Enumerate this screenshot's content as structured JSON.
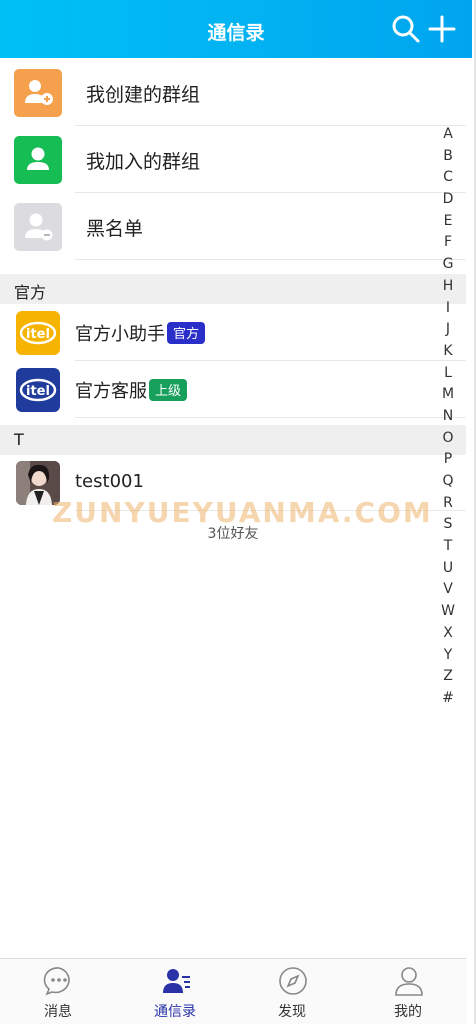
{
  "header": {
    "title": "通信录"
  },
  "groups": [
    {
      "label": "我创建的群组",
      "icon": "create-group-icon",
      "color": "#f5a04c"
    },
    {
      "label": "我加入的群组",
      "icon": "joined-group-icon",
      "color": "#16bd55"
    },
    {
      "label": "黑名单",
      "icon": "blacklist-icon",
      "color": "#dcdce0"
    }
  ],
  "sections": [
    {
      "title": "官方",
      "contacts": [
        {
          "name": "官方小助手",
          "badge": "官方",
          "badge_color": "#2a2fc9",
          "logo_text": "itel",
          "logo_color": "#f6b400"
        },
        {
          "name": "官方客服",
          "badge": "上级",
          "badge_color": "#17a05b",
          "logo_text": "itel",
          "logo_color": "#1f3c9c"
        }
      ]
    },
    {
      "title": "T",
      "contacts": [
        {
          "name": "test001"
        }
      ]
    }
  ],
  "index_letters": [
    "A",
    "B",
    "C",
    "D",
    "E",
    "F",
    "G",
    "H",
    "I",
    "J",
    "K",
    "L",
    "M",
    "N",
    "O",
    "P",
    "Q",
    "R",
    "S",
    "T",
    "U",
    "V",
    "W",
    "X",
    "Y",
    "Z",
    "#"
  ],
  "watermark": "ZUNYUEYUANMA.COM",
  "friend_count": "3位好友",
  "nav": [
    {
      "label": "消息",
      "icon": "message-icon"
    },
    {
      "label": "通信录",
      "icon": "contacts-icon",
      "active": true
    },
    {
      "label": "发现",
      "icon": "discover-icon"
    },
    {
      "label": "我的",
      "icon": "profile-icon"
    }
  ],
  "colors": {
    "header": "#00b4f2",
    "accent": "#2a32a8"
  }
}
